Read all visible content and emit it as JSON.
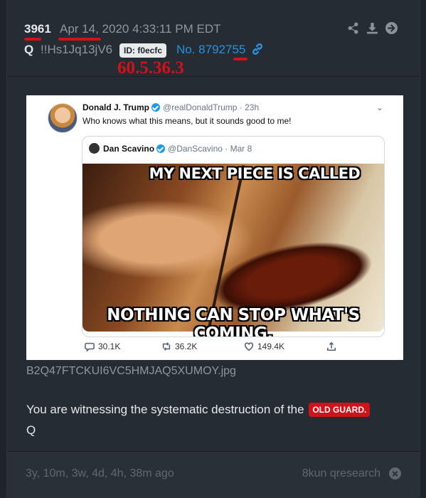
{
  "post": {
    "number": "3961",
    "date": "Apr 14, 2020 4:33:11 PM EDT",
    "author": "Q",
    "tripcode": "!!Hs1Jq13jV6",
    "id_badge": "ID: f0ecfc",
    "post_no": "No. 8792755",
    "ip_annotation": "60.5.36.3",
    "filename": "B2Q47FTCKUI6VC5HMJAQ5XUMOY.jpg",
    "message": "You are witnessing the systematic destruction of the",
    "message_badge": "OLD GUARD.",
    "signature": "Q"
  },
  "tweet": {
    "name": "Donald J. Trump",
    "handle_time": "@realDonaldTrump · 23h",
    "text": "Who knows what this means, but it sounds good to me!",
    "quoted_name": "Dan Scavino",
    "quoted_handle_time": "@DanScavino · Mar 8",
    "meme_top": "MY NEXT PIECE IS CALLED",
    "meme_bottom": "NOTHING CAN STOP WHAT'S COMING.",
    "replies": "30.1K",
    "retweets": "36.2K",
    "likes": "149.4K"
  },
  "footer": {
    "age": "3y, 10m, 3w, 4d, 4h, 38m ago",
    "board": "8kun qresearch"
  },
  "icons": {
    "header": [
      "share-icon",
      "download-icon",
      "arrow-right-circle-icon"
    ],
    "link": "link-icon",
    "close": "close-circle-icon"
  },
  "colors": {
    "accent_blue": "#2b91d8",
    "annotation_red": "#d0121b",
    "background": "#262c34"
  }
}
